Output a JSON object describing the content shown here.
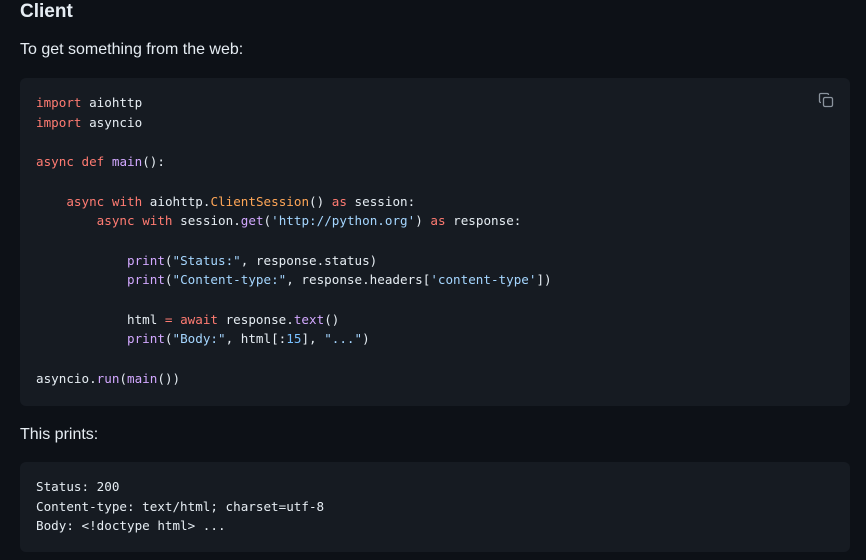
{
  "heading": "Client",
  "intro": "To get something from the web:",
  "code_lines": [
    [
      {
        "t": "import",
        "c": "kw"
      },
      {
        "t": " aiohttp"
      }
    ],
    [
      {
        "t": "import",
        "c": "kw"
      },
      {
        "t": " asyncio"
      }
    ],
    [],
    [
      {
        "t": "async",
        "c": "kw"
      },
      {
        "t": " "
      },
      {
        "t": "def",
        "c": "kw"
      },
      {
        "t": " "
      },
      {
        "t": "main",
        "c": "fn"
      },
      {
        "t": "():"
      }
    ],
    [],
    [
      {
        "t": "    "
      },
      {
        "t": "async",
        "c": "kw"
      },
      {
        "t": " "
      },
      {
        "t": "with",
        "c": "kw"
      },
      {
        "t": " aiohttp."
      },
      {
        "t": "ClientSession",
        "c": "cls"
      },
      {
        "t": "() "
      },
      {
        "t": "as",
        "c": "kw"
      },
      {
        "t": " session:"
      }
    ],
    [
      {
        "t": "        "
      },
      {
        "t": "async",
        "c": "kw"
      },
      {
        "t": " "
      },
      {
        "t": "with",
        "c": "kw"
      },
      {
        "t": " session."
      },
      {
        "t": "get",
        "c": "fn"
      },
      {
        "t": "("
      },
      {
        "t": "'http://python.org'",
        "c": "str"
      },
      {
        "t": ") "
      },
      {
        "t": "as",
        "c": "kw"
      },
      {
        "t": " response:"
      }
    ],
    [],
    [
      {
        "t": "            "
      },
      {
        "t": "print",
        "c": "fn"
      },
      {
        "t": "("
      },
      {
        "t": "\"Status:\"",
        "c": "str"
      },
      {
        "t": ", response.status)"
      }
    ],
    [
      {
        "t": "            "
      },
      {
        "t": "print",
        "c": "fn"
      },
      {
        "t": "("
      },
      {
        "t": "\"Content-type:\"",
        "c": "str"
      },
      {
        "t": ", response.headers["
      },
      {
        "t": "'content-type'",
        "c": "str"
      },
      {
        "t": "])"
      }
    ],
    [],
    [
      {
        "t": "            html "
      },
      {
        "t": "=",
        "c": "kw"
      },
      {
        "t": " "
      },
      {
        "t": "await",
        "c": "kw"
      },
      {
        "t": " response."
      },
      {
        "t": "text",
        "c": "fn"
      },
      {
        "t": "()"
      }
    ],
    [
      {
        "t": "            "
      },
      {
        "t": "print",
        "c": "fn"
      },
      {
        "t": "("
      },
      {
        "t": "\"Body:\"",
        "c": "str"
      },
      {
        "t": ", html[:"
      },
      {
        "t": "15",
        "c": "num"
      },
      {
        "t": "], "
      },
      {
        "t": "\"...\"",
        "c": "str"
      },
      {
        "t": ")"
      }
    ],
    [],
    [
      {
        "t": "asyncio."
      },
      {
        "t": "run",
        "c": "fn"
      },
      {
        "t": "("
      },
      {
        "t": "main",
        "c": "fn"
      },
      {
        "t": "())"
      }
    ]
  ],
  "copy_icon": "copy-icon",
  "prints_label": "This prints:",
  "output_lines": [
    "Status: 200",
    "Content-type: text/html; charset=utf-8",
    "Body: <!doctype html> ..."
  ],
  "colors": {
    "background": "#0d1117",
    "code_background": "#161b22",
    "keyword": "#ff7b72",
    "function": "#d2a8ff",
    "string": "#a5d6ff",
    "class": "#ffa657",
    "number": "#79c0ff"
  }
}
